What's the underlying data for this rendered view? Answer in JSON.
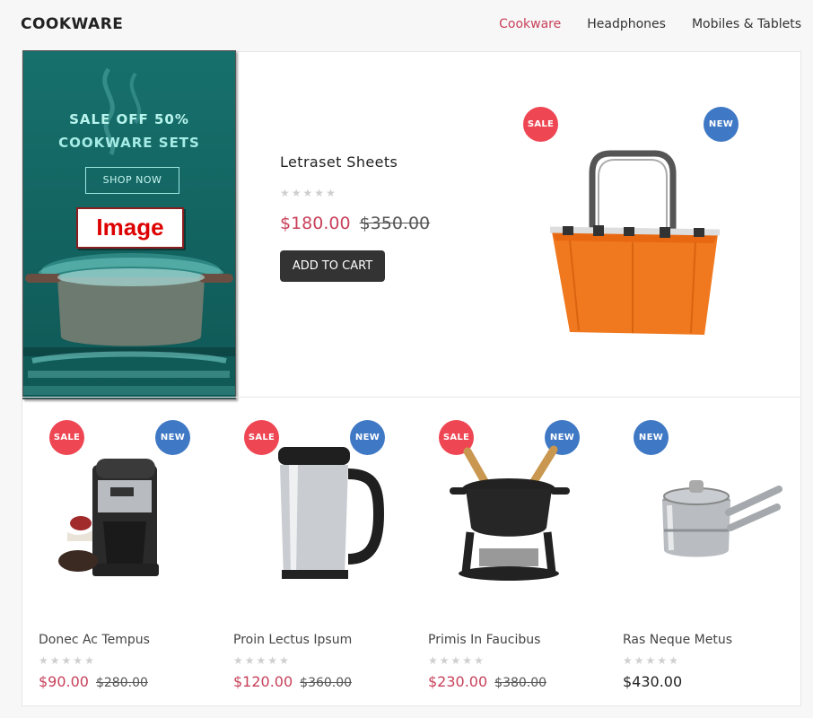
{
  "brand": "COOKWARE",
  "nav": [
    {
      "label": "Cookware",
      "active": true
    },
    {
      "label": "Headphones",
      "active": false
    },
    {
      "label": "Mobiles & Tablets",
      "active": false
    }
  ],
  "banner": {
    "line1": "SALE OFF 50%",
    "line2": "COOKWARE SETS",
    "button": "SHOP NOW",
    "image_label": "Image"
  },
  "badges": {
    "sale": "SALE",
    "new": "NEW"
  },
  "featured": {
    "title": "Letraset Sheets",
    "rating": 0,
    "price": "$180.00",
    "old_price": "$350.00",
    "cart_label": "ADD TO CART",
    "sale": true,
    "new": true
  },
  "products": [
    {
      "name": "Donec Ac Tempus",
      "price": "$90.00",
      "old_price": "$280.00",
      "sale": true,
      "new": true,
      "rating": 0
    },
    {
      "name": "Proin Lectus Ipsum",
      "price": "$120.00",
      "old_price": "$360.00",
      "sale": true,
      "new": true,
      "rating": 0
    },
    {
      "name": "Primis In Faucibus",
      "price": "$230.00",
      "old_price": "$380.00",
      "sale": true,
      "new": true,
      "rating": 0
    },
    {
      "name": "Ras Neque Metus",
      "price": "$430.00",
      "old_price": "",
      "sale": false,
      "new": true,
      "rating": 0
    }
  ],
  "colors": {
    "accent": "#c8415a",
    "sale": "#ee4653",
    "new": "#3f78c4",
    "button": "#333333"
  }
}
